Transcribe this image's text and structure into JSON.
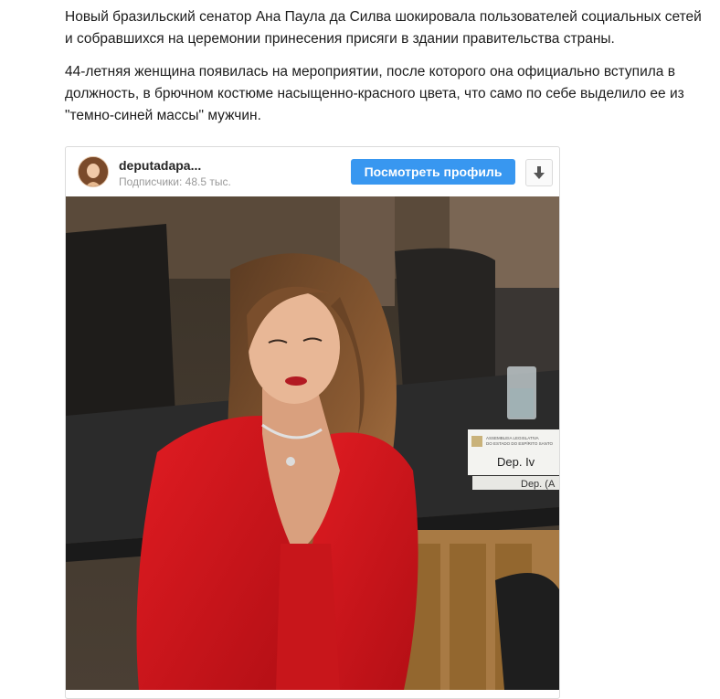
{
  "article": {
    "paragraphs": [
      "Новый бразильский сенатор Ана Паула да Силва шокировала пользователей социальных сетей и собравшихся на церемонии принесения присяги в здании правительства страны.",
      "44-летняя женщина появилась на мероприятии, после которого она официально вступила в должность, в брючном костюме насыщенно-красного цвета, что само по себе выделило ее из \"темно-синей массы\" мужчин."
    ]
  },
  "embed": {
    "username": "deputadapa...",
    "followers": "Подписчики: 48.5 тыс.",
    "view_profile_label": "Посмотреть профиль",
    "download_icon": "download-arrow-icon",
    "photo": {
      "nameplate_line1": "ASSEMBLEIA LEGISLATIVA",
      "nameplate_line2": "DO ESTADO DO ESPÍRITO SANTO",
      "nameplate_name": "Dep. Iv",
      "nameplate_name_lower": "Dep. (A"
    }
  },
  "colors": {
    "button": "#3897f0",
    "jacket": "#d8151c",
    "desk": "#2a2a2a",
    "wood": "#a8783e"
  }
}
